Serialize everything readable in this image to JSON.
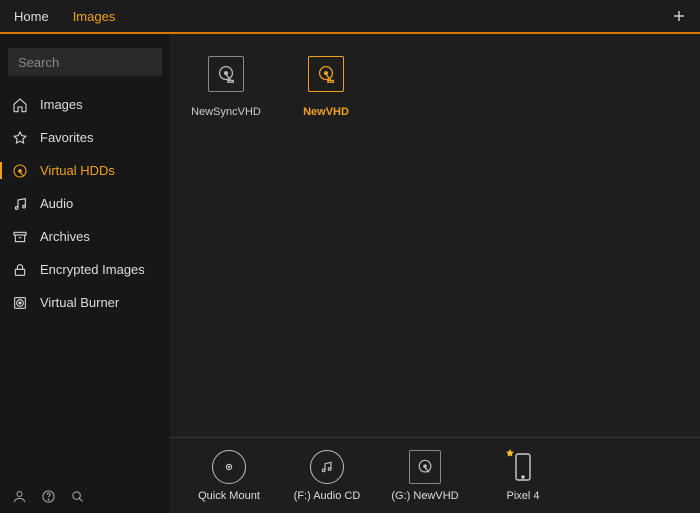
{
  "tabs": {
    "home": "Home",
    "images": "Images"
  },
  "search": {
    "placeholder": "Search"
  },
  "sidebar": {
    "items": [
      {
        "label": "Images"
      },
      {
        "label": "Favorites"
      },
      {
        "label": "Virtual HDDs"
      },
      {
        "label": "Audio"
      },
      {
        "label": "Archives"
      },
      {
        "label": "Encrypted Images"
      },
      {
        "label": "Virtual Burner"
      }
    ]
  },
  "content": {
    "items": [
      {
        "label": "NewSyncVHD"
      },
      {
        "label": "NewVHD"
      }
    ]
  },
  "bottombar": {
    "items": [
      {
        "label": "Quick Mount"
      },
      {
        "label": "(F:) Audio CD"
      },
      {
        "label": "(G:) NewVHD"
      },
      {
        "label": "Pixel 4"
      }
    ]
  },
  "colors": {
    "accent": "#f0a020"
  }
}
